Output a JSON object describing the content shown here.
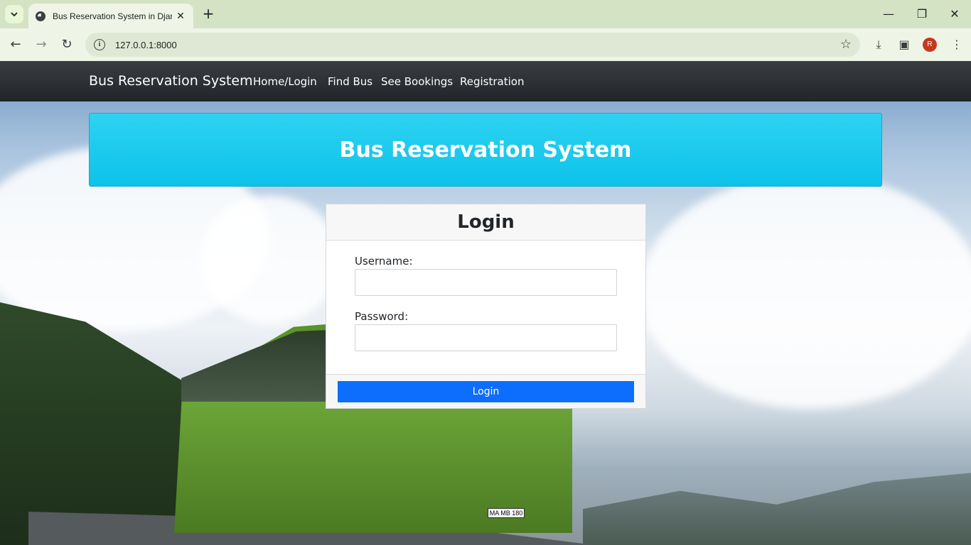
{
  "browser": {
    "tab_title": "Bus Reservation System in Djan",
    "url": "127.0.0.1:8000",
    "avatar_letter": "R",
    "icons": [
      "tab-search-icon",
      "globe-icon",
      "close-icon",
      "plus-icon",
      "minimize-icon",
      "restore-icon",
      "back-icon",
      "forward-icon",
      "reload-icon",
      "info-icon",
      "star-icon",
      "download-icon",
      "sidepanel-icon",
      "kebab-menu-icon"
    ]
  },
  "navbar": {
    "brand": "Bus Reservation System",
    "links": [
      "Home/Login",
      "Find Bus",
      "See Bookings",
      "Registration"
    ]
  },
  "hero": {
    "title": "Bus Reservation System",
    "bus_plate": "MA MB 180"
  },
  "login": {
    "title": "Login",
    "username_label": "Username:",
    "username_value": "",
    "password_label": "Password:",
    "password_value": "",
    "button_label": "Login"
  },
  "colors": {
    "navbar_bg": "#212529",
    "jumbotron_bg": "#1ccbee",
    "button_bg": "#0d6efd"
  }
}
